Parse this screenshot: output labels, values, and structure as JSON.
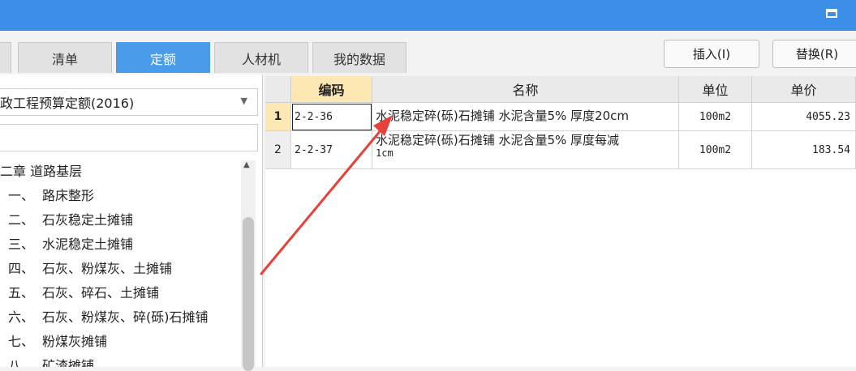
{
  "window": {
    "restore_icon": "restore-icon"
  },
  "tabs": [
    {
      "label": "清单",
      "active": false
    },
    {
      "label": "定额",
      "active": true
    },
    {
      "label": "人材机",
      "active": false
    },
    {
      "label": "我的数据",
      "active": false
    }
  ],
  "actions": {
    "insert_label": "插入(I)",
    "replace_label": "替换(R)"
  },
  "left": {
    "library_value": "政工程预算定额(2016)",
    "search_value": "",
    "tree": [
      {
        "num": "二章",
        "label": "道路基层"
      },
      {
        "num": "一、",
        "label": "路床整形"
      },
      {
        "num": "二、",
        "label": "石灰稳定土摊铺"
      },
      {
        "num": "三、",
        "label": "水泥稳定土摊铺"
      },
      {
        "num": "四、",
        "label": "石灰、粉煤灰、土摊铺"
      },
      {
        "num": "五、",
        "label": "石灰、碎石、土摊铺"
      },
      {
        "num": "六、",
        "label": "石灰、粉煤灰、碎(砾)石摊铺"
      },
      {
        "num": "七、",
        "label": "粉煤灰摊铺"
      },
      {
        "num": "八、",
        "label": "矿渣摊铺"
      }
    ]
  },
  "grid": {
    "headers": {
      "code": "编码",
      "name": "名称",
      "unit": "单位",
      "price": "单价"
    },
    "rows": [
      {
        "index": "1",
        "code": "2-2-36",
        "name": "水泥稳定碎(砾)石摊铺 水泥含量5% 厚度20cm",
        "name_line2": "",
        "unit": "100m2",
        "price": "4055.23",
        "selected": true
      },
      {
        "index": "2",
        "code": "2-2-37",
        "name": "水泥稳定碎(砾)石摊铺 水泥含量5% 厚度每减",
        "name_line2": "1cm",
        "unit": "100m2",
        "price": "183.54",
        "selected": false
      }
    ]
  },
  "annotation": {
    "color": "#e8413a"
  }
}
